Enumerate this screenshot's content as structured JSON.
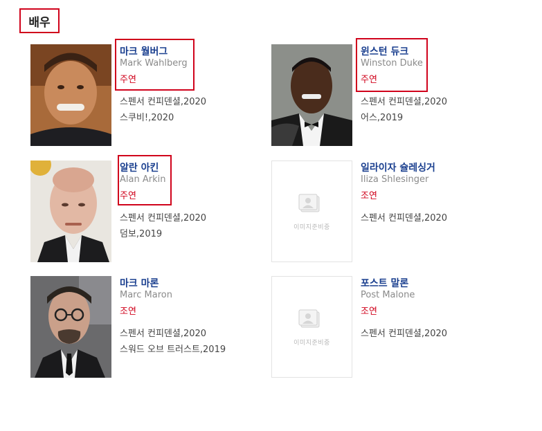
{
  "section": {
    "title": "배우"
  },
  "placeholder_text": "이미지준비중",
  "actors": [
    {
      "name_ko": "마크 월버그",
      "name_en": "Mark Wahlberg",
      "role": "주연",
      "films": [
        "스펜서 컨피덴셜,2020",
        "스쿠비!,2020"
      ],
      "photo": "photo"
    },
    {
      "name_ko": "윈스턴 듀크",
      "name_en": "Winston Duke",
      "role": "주연",
      "films": [
        "스펜서 컨피덴셜,2020",
        "어스,2019"
      ],
      "photo": "photo"
    },
    {
      "name_ko": "알란 아킨",
      "name_en": "Alan Arkin",
      "role": "주연",
      "films": [
        "스펜서 컨피덴셜,2020",
        "덤보,2019"
      ],
      "photo": "photo"
    },
    {
      "name_ko": "일라이자 슐레싱거",
      "name_en": "Iliza Shlesinger",
      "role": "조연",
      "films": [
        "스펜서 컨피덴셜,2020"
      ],
      "photo": "placeholder"
    },
    {
      "name_ko": "마크 마론",
      "name_en": "Marc Maron",
      "role": "조연",
      "films": [
        "스펜서 컨피덴셜,2020",
        "스워드 오브 트러스트,2019"
      ],
      "photo": "photo"
    },
    {
      "name_ko": "포스트 말론",
      "name_en": "Post Malone",
      "role": "조연",
      "films": [
        "스펜서 컨피덴셜,2020"
      ],
      "photo": "placeholder"
    }
  ],
  "colors": {
    "name": "#1a3f8f",
    "role": "#d0021b",
    "highlight": "#d0021b",
    "muted": "#8a8a8a"
  }
}
